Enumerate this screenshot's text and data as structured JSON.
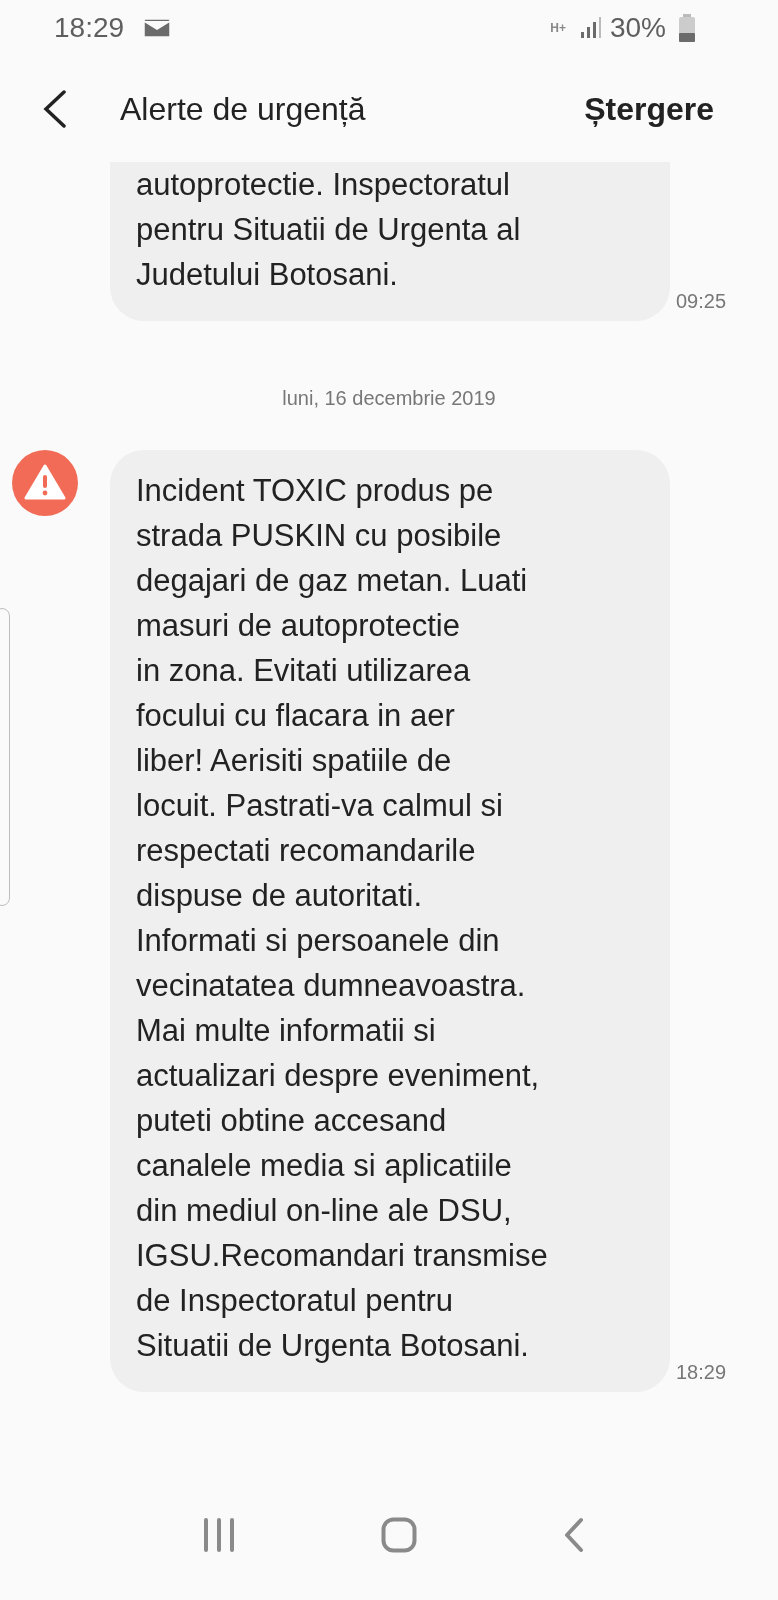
{
  "status_bar": {
    "time": "18:29",
    "network_type": "H+",
    "battery": "30%"
  },
  "header": {
    "title": "Alerte de urgență",
    "action": "Ștergere"
  },
  "items": [
    {
      "kind": "message",
      "cut_top": true,
      "icon": false,
      "text": "autoprotectie. Inspectoratul\npentru Situatii de Urgenta al\nJudetului Botosani.",
      "time": "09:25"
    },
    {
      "kind": "date",
      "text": "luni, 16 decembrie 2019"
    },
    {
      "kind": "message",
      "cut_top": false,
      "icon": true,
      "text": "Incident TOXIC produs pe\nstrada PUSKIN cu posibile\ndegajari de gaz metan. Luati\nmasuri de autoprotectie\nin zona. Evitati utilizarea\nfocului cu flacara in aer\nliber! Aerisiti spatiile de\nlocuit. Pastrati-va calmul si\nrespectati recomandarile\ndispuse de autoritati.\nInformati si persoanele din\nvecinatatea dumneavoastra.\nMai multe informatii si\nactualizari despre eveniment,\nputeti obtine accesand\ncanalele media si aplicatiile\ndin mediul on-line ale DSU,\nIGSU.Recomandari transmise\nde Inspectoratul pentru\nSituatii de Urgenta Botosani.",
      "time": "18:29"
    }
  ]
}
